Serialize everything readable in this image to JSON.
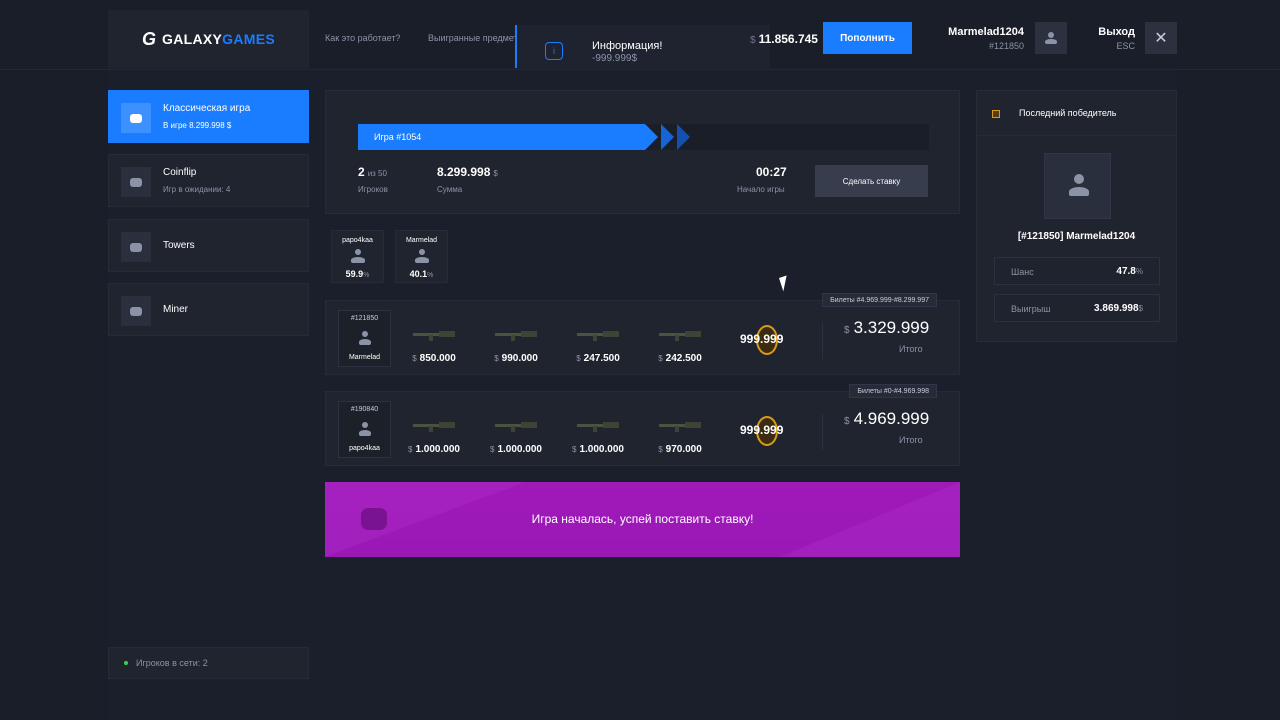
{
  "header": {
    "logo_mark": "G",
    "logo_main": "GALAXY",
    "logo_accent": "GAMES",
    "nav": [
      "Как это работает?",
      "Выигранные предметы"
    ],
    "balance_currency": "$",
    "balance": "11.856.745",
    "deposit_label": "Пополнить",
    "username": "Marmelad1204",
    "user_id": "#121850",
    "logout_label": "Выход",
    "logout_hint": "ESC"
  },
  "notification": {
    "icon": "info-icon",
    "title": "Информация!",
    "text": "-999.999$"
  },
  "sidebar": {
    "modes": [
      {
        "title": "Классическая игра",
        "subtitle": "В игре 8.299.998 $"
      },
      {
        "title": "Coinflip",
        "subtitle": "Игр в ожидании: 4"
      },
      {
        "title": "Towers",
        "subtitle": ""
      },
      {
        "title": "Miner",
        "subtitle": ""
      }
    ],
    "online": "Игроков в сети: 2"
  },
  "game": {
    "label": "Игра #1054",
    "progress_percent": 52,
    "players_value": "2",
    "players_of": "из 50",
    "players_label": "Игроков",
    "sum_value": "8.299.998",
    "sum_currency": "$",
    "sum_label": "Сумма",
    "timer": "00:27",
    "timer_label": "Начало игры",
    "bet_button": "Сделать ставку"
  },
  "chances": [
    {
      "name": "papo4kaa",
      "value": "59.9",
      "unit": "%"
    },
    {
      "name": "Marmelad",
      "value": "40.1",
      "unit": "%"
    }
  ],
  "bets": [
    {
      "tickets": "Билеты #4.969.999-#8.299.997",
      "user_id": "#121850",
      "user_name": "Marmelad",
      "items": [
        "850.000",
        "990.000",
        "247.500",
        "242.500"
      ],
      "coin_value": "999.999",
      "total": "3.329.999",
      "total_label": "Итого"
    },
    {
      "tickets": "Билеты #0-#4.969.998",
      "user_id": "#190840",
      "user_name": "papo4kaa",
      "items": [
        "1.000.000",
        "1.000.000",
        "1.000.000",
        "970.000"
      ],
      "coin_value": "999.999",
      "total": "4.969.999",
      "total_label": "Итого"
    }
  ],
  "currency": "$",
  "banner": {
    "text": "Игра началась, успей поставить ставку!"
  },
  "winner": {
    "title": "Последний победитель",
    "name": "[#121850] Marmelad1204",
    "chance_label": "Шанс",
    "chance_value": "47.8",
    "chance_unit": "%",
    "win_label": "Выигрыш",
    "win_value": "3.869.998",
    "win_unit": "$"
  },
  "colors": {
    "accent": "#1a7cff",
    "banner": "#a019b9",
    "gold": "#d89a1a",
    "online": "#39d353"
  }
}
